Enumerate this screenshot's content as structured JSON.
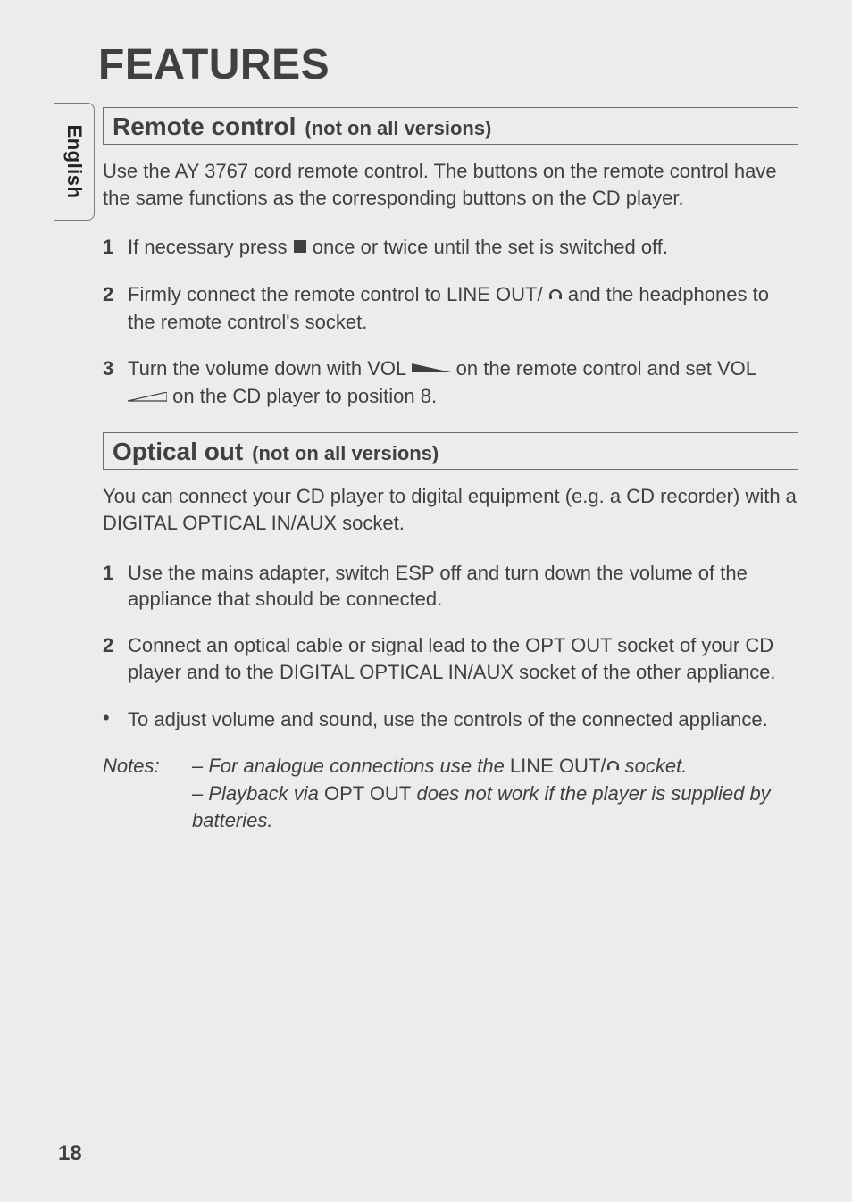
{
  "page_title": "FEATURES",
  "side_tab": "English",
  "page_number": "18",
  "sections": {
    "remote": {
      "title": "Remote control",
      "sub": "(not on all versions)",
      "intro": "Use the AY 3767 cord remote control. The buttons on the remote control have the same functions as the corresponding buttons on the CD player.",
      "steps": {
        "s1a": "If necessary press ",
        "s1b": " once or twice until the set is switched off.",
        "s2a": "Firmly connect the remote control to LINE OUT/",
        "s2b": " and the headphones to the remote control's socket.",
        "s3a": "Turn the volume down with VOL ",
        "s3b": " on the remote control and set VOL ",
        "s3c": " on the CD player to position 8."
      }
    },
    "optical": {
      "title": "Optical out",
      "sub": "(not on all versions)",
      "intro": "You can connect your CD player to digital equipment (e.g. a CD recorder) with a DIGITAL OPTICAL IN/AUX socket.",
      "steps": {
        "s1": "Use the mains adapter, switch ESP off and turn down the volume of the appliance that should be connected.",
        "s2": "Connect an optical cable or signal lead to the OPT OUT socket of your CD player and to the DIGITAL OPTICAL IN/AUX socket of the other appliance."
      },
      "bullet": "To adjust volume and sound, use the controls of the connected appliance.",
      "notes_label": "Notes:",
      "note1a": "– For analogue connections use the ",
      "note1b": "LINE OUT/",
      "note1c": " socket.",
      "note2a": "– Playback via ",
      "note2b": "OPT OUT",
      "note2c": " does not work if the player is supplied by batteries."
    }
  },
  "icons": {
    "stop": "stop",
    "headphones": "headphones",
    "wedge_down": "volume-down-wedge",
    "wedge_up": "volume-up-wedge"
  }
}
